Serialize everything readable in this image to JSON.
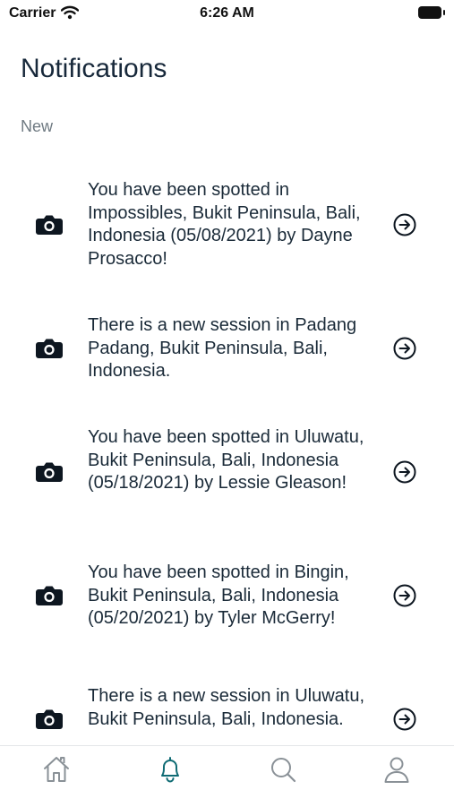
{
  "status_bar": {
    "carrier": "Carrier",
    "time": "6:26 AM"
  },
  "header": {
    "title": "Notifications"
  },
  "section": {
    "label": "New"
  },
  "notifications": [
    {
      "icon": "camera-icon",
      "text": "You have been spotted in Impossibles, Bukit Peninsula, Bali, Indonesia (05/08/2021) by Dayne Prosacco!"
    },
    {
      "icon": "camera-icon",
      "text": "There is a new session in Padang Padang, Bukit Peninsula, Bali, Indonesia."
    },
    {
      "icon": "camera-icon",
      "text": "You have been spotted in Uluwatu, Bukit Peninsula, Bali, Indonesia (05/18/2021) by Lessie Gleason!"
    },
    {
      "icon": "camera-icon",
      "text": "You have been spotted in Bingin, Bukit Peninsula, Bali, Indonesia (05/20/2021) by Tyler McGerry!"
    },
    {
      "icon": "camera-icon",
      "text": "There is a new session in Uluwatu, Bukit Peninsula, Bali, Indonesia."
    }
  ],
  "tab_bar": {
    "tabs": [
      {
        "icon": "home-icon",
        "active": false
      },
      {
        "icon": "bell-icon",
        "active": true
      },
      {
        "icon": "search-icon",
        "active": false
      },
      {
        "icon": "profile-icon",
        "active": false
      }
    ]
  },
  "colors": {
    "active_tab": "#0f6b74",
    "inactive_tab": "#8a9197",
    "text": "#1a2a38"
  }
}
